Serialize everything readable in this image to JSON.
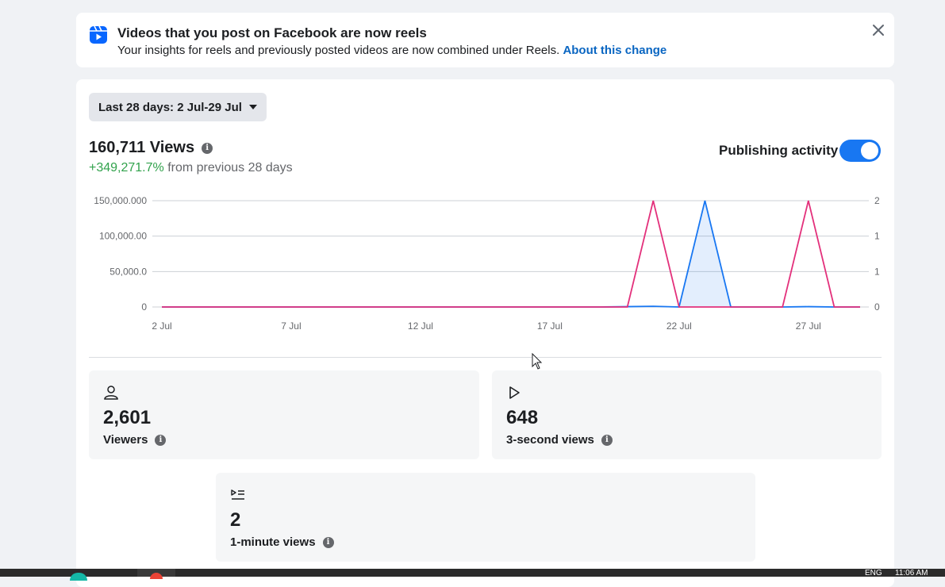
{
  "banner": {
    "title": "Videos that you post on Facebook are now reels",
    "text": "Your insights for reels and previously posted videos are now combined under Reels.",
    "link": "About this change",
    "icon": "reels-icon",
    "close_icon": "close-icon"
  },
  "filter": {
    "date_range": "Last 28 days: 2 Jul-29 Jul"
  },
  "summary": {
    "views": "160,711 Views",
    "change": "+349,271.7%",
    "change_suffix": "from previous 28 days",
    "publishing_activity_label": "Publishing activity",
    "publishing_activity_on": true
  },
  "chart_data": {
    "type": "line",
    "x": [
      "2 Jul",
      "3 Jul",
      "4 Jul",
      "5 Jul",
      "6 Jul",
      "7 Jul",
      "8 Jul",
      "9 Jul",
      "10 Jul",
      "11 Jul",
      "12 Jul",
      "13 Jul",
      "14 Jul",
      "15 Jul",
      "16 Jul",
      "17 Jul",
      "18 Jul",
      "19 Jul",
      "20 Jul",
      "21 Jul",
      "22 Jul",
      "23 Jul",
      "24 Jul",
      "25 Jul",
      "26 Jul",
      "27 Jul",
      "28 Jul",
      "29 Jul"
    ],
    "x_tick_labels": [
      "2 Jul",
      "7 Jul",
      "12 Jul",
      "17 Jul",
      "22 Jul",
      "27 Jul"
    ],
    "y_left_ticks": [
      "0",
      "50,000.0",
      "100,000.00",
      "150,000.000"
    ],
    "y_right_ticks": [
      "0",
      "1",
      "1",
      "2"
    ],
    "ylim_left": [
      0,
      150000
    ],
    "ylim_right": [
      0,
      2
    ],
    "series": [
      {
        "axis": "left",
        "color": "#1877f2",
        "fill": true,
        "values": [
          0,
          0,
          0,
          0,
          0,
          0,
          0,
          0,
          0,
          0,
          0,
          0,
          0,
          0,
          0,
          0,
          0,
          0,
          500,
          1000,
          0,
          150000,
          0,
          0,
          0,
          500,
          0,
          0
        ]
      },
      {
        "axis": "right",
        "color": "#e3307b",
        "fill": false,
        "values": [
          0,
          0,
          0,
          0,
          0,
          0,
          0,
          0,
          0,
          0,
          0,
          0,
          0,
          0,
          0,
          0,
          0,
          0,
          0,
          2,
          0,
          0,
          0,
          0,
          0,
          2,
          0,
          0
        ]
      }
    ],
    "grid": true
  },
  "stats": [
    {
      "icon": "person-icon",
      "value": "2,601",
      "label": "Viewers"
    },
    {
      "icon": "play-icon",
      "value": "648",
      "label": "3-second views"
    },
    {
      "icon": "play-list-icon",
      "value": "2",
      "label": "1-minute views"
    }
  ],
  "taskbar": {
    "lang": "ENG",
    "time": "11:06 AM"
  }
}
